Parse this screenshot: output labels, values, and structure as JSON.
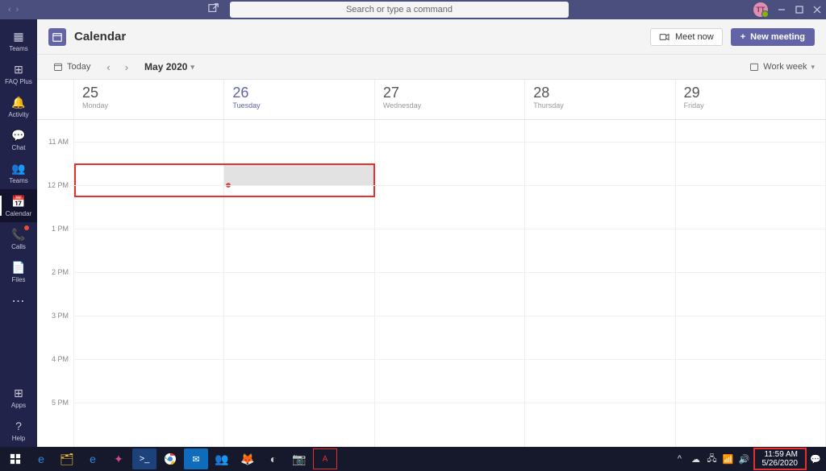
{
  "titlebar": {
    "search_placeholder": "Search or type a command",
    "avatar_initials": "TT"
  },
  "rail": {
    "items": [
      {
        "key": "teams-top",
        "label": "Teams"
      },
      {
        "key": "faq",
        "label": "FAQ Plus"
      },
      {
        "key": "activity",
        "label": "Activity"
      },
      {
        "key": "chat",
        "label": "Chat"
      },
      {
        "key": "teams",
        "label": "Teams"
      },
      {
        "key": "calendar",
        "label": "Calendar"
      },
      {
        "key": "calls",
        "label": "Calls"
      },
      {
        "key": "files",
        "label": "Files"
      }
    ],
    "apps_label": "Apps",
    "help_label": "Help"
  },
  "header": {
    "title": "Calendar",
    "meet_now_label": "Meet now",
    "new_meeting_label": "New meeting"
  },
  "toolbar": {
    "today_label": "Today",
    "month_label": "May 2020",
    "view_label": "Work week"
  },
  "calendar": {
    "days": [
      {
        "num": "25",
        "dow": "Monday",
        "today": false
      },
      {
        "num": "26",
        "dow": "Tuesday",
        "today": true
      },
      {
        "num": "27",
        "dow": "Wednesday",
        "today": false
      },
      {
        "num": "28",
        "dow": "Thursday",
        "today": false
      },
      {
        "num": "29",
        "dow": "Friday",
        "today": false
      }
    ],
    "hours": [
      "11 AM",
      "12 PM",
      "1 PM",
      "2 PM",
      "3 PM",
      "4 PM",
      "5 PM"
    ]
  },
  "taskbar": {
    "time": "11:59 AM",
    "date": "5/26/2020"
  }
}
